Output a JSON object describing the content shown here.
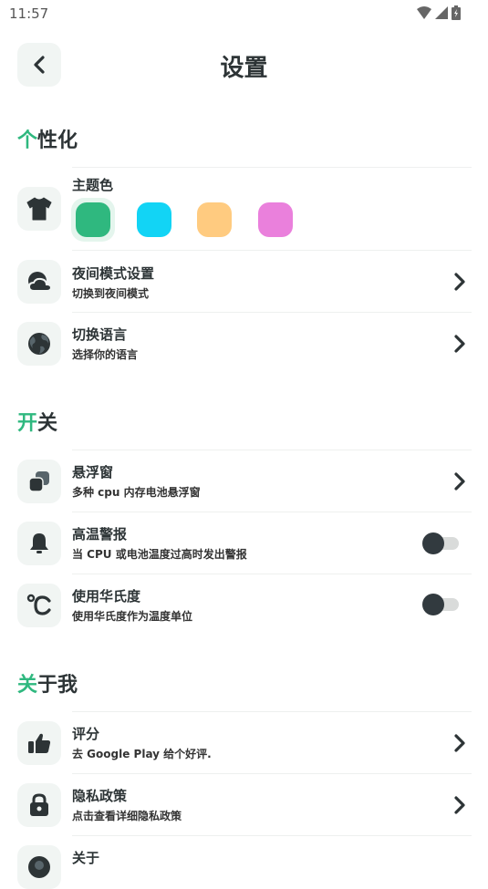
{
  "status": {
    "time": "11:57"
  },
  "header": {
    "title": "设置"
  },
  "sections": {
    "personalization": {
      "accent": "个",
      "rest": "性化"
    },
    "switches": {
      "accent": "开",
      "rest": "关"
    },
    "about": {
      "accent": "关",
      "rest": "于我"
    }
  },
  "theme": {
    "title": "主题色",
    "colors": [
      "#2fb87f",
      "#12d4f5",
      "#ffcb80",
      "#ea80dc"
    ],
    "selected_index": 0
  },
  "rows": {
    "night_mode": {
      "title": "夜间模式设置",
      "subtitle": "切换到夜间模式"
    },
    "language": {
      "title": "切换语言",
      "subtitle": "选择你的语言"
    },
    "floating_window": {
      "title": "悬浮窗",
      "subtitle": "多种 cpu 内存电池悬浮窗"
    },
    "high_temp_alert": {
      "title": "高温警报",
      "subtitle": "当 CPU 或电池温度过高时发出警报",
      "enabled": false
    },
    "fahrenheit": {
      "title": "使用华氏度",
      "subtitle": "使用华氏度作为温度单位",
      "enabled": false
    },
    "rating": {
      "title": "评分",
      "subtitle": "去 Google Play 给个好评."
    },
    "privacy": {
      "title": "隐私政策",
      "subtitle": "点击查看详细隐私政策"
    },
    "about_app": {
      "title": "关于"
    }
  },
  "colors": {
    "accent": "#2fb87f",
    "text": "#2d3436",
    "icon_bg": "#f1f5f3"
  }
}
